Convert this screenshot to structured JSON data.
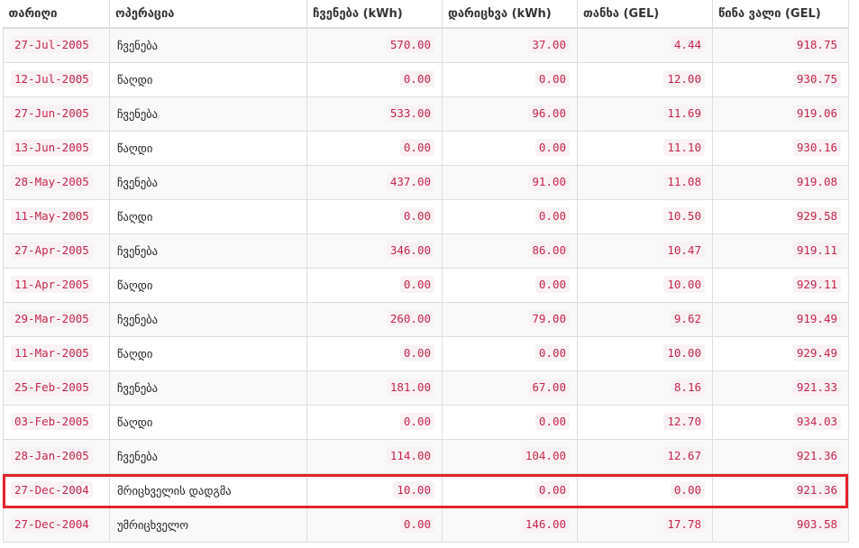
{
  "table": {
    "headers": [
      "თარიღი",
      "ოპერაცია",
      "ჩვენება (kWh)",
      "დარიცხვა (kWh)",
      "თანხა (GEL)",
      "წინა ვალი (GEL)"
    ],
    "rows": [
      [
        "27-Jul-2005",
        "ჩვენება",
        "570.00",
        "37.00",
        "4.44",
        "918.75"
      ],
      [
        "12-Jul-2005",
        "წაღდი",
        "0.00",
        "0.00",
        "12.00",
        "930.75"
      ],
      [
        "27-Jun-2005",
        "ჩვენება",
        "533.00",
        "96.00",
        "11.69",
        "919.06"
      ],
      [
        "13-Jun-2005",
        "წაღდი",
        "0.00",
        "0.00",
        "11.10",
        "930.16"
      ],
      [
        "28-May-2005",
        "ჩვენება",
        "437.00",
        "91.00",
        "11.08",
        "919.08"
      ],
      [
        "11-May-2005",
        "წაღდი",
        "0.00",
        "0.00",
        "10.50",
        "929.58"
      ],
      [
        "27-Apr-2005",
        "ჩვენება",
        "346.00",
        "86.00",
        "10.47",
        "919.11"
      ],
      [
        "11-Apr-2005",
        "წაღდი",
        "0.00",
        "0.00",
        "10.00",
        "929.11"
      ],
      [
        "29-Mar-2005",
        "ჩვენება",
        "260.00",
        "79.00",
        "9.62",
        "919.49"
      ],
      [
        "11-Mar-2005",
        "წაღდი",
        "0.00",
        "0.00",
        "10.00",
        "929.49"
      ],
      [
        "25-Feb-2005",
        "ჩვენება",
        "181.00",
        "67.00",
        "8.16",
        "921.33"
      ],
      [
        "03-Feb-2005",
        "წაღდი",
        "0.00",
        "0.00",
        "12.70",
        "934.03"
      ],
      [
        "28-Jan-2005",
        "ჩვენება",
        "114.00",
        "104.00",
        "12.67",
        "921.36"
      ],
      [
        "27-Dec-2004",
        "მრიცხველის დადგმა",
        "10.00",
        "0.00",
        "0.00",
        "921.36"
      ],
      [
        "27-Dec-2004",
        "უმრიცხველო",
        "0.00",
        "146.00",
        "17.78",
        "903.58"
      ]
    ],
    "highlighted_row": 13
  },
  "colors": {
    "code_text": "#c7254e",
    "code_bg": "#f9f2f4",
    "highlight_border": "#e3232b",
    "row_stripe": "#f9f9f9"
  }
}
